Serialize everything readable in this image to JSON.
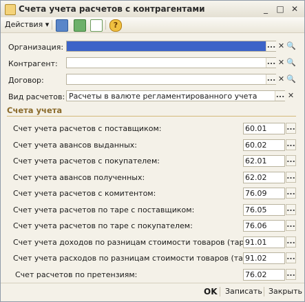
{
  "window": {
    "title": "Счета учета расчетов с контрагентами",
    "controls": {
      "minimize": "_",
      "maximize": "□",
      "close": "✕"
    }
  },
  "toolbar": {
    "actions_label": "Действия",
    "actions_arrow": "▾",
    "help_glyph": "?"
  },
  "form": {
    "organization": {
      "label": "Организация:",
      "value": ""
    },
    "counterparty": {
      "label": "Контрагент:",
      "value": ""
    },
    "contract": {
      "label": "Договор:",
      "value": ""
    },
    "settlement_type": {
      "label": "Вид расчетов:",
      "value": "Расчеты в валюте регламентированного учета"
    },
    "dots": "...",
    "clear": "✕",
    "search": "🔍"
  },
  "accounts": {
    "section_title": "Счета учета",
    "rows": [
      {
        "label": "Счет учета расчетов с поставщиком:",
        "value": "60.01"
      },
      {
        "label": "Счет учета авансов выданных:",
        "value": "60.02"
      },
      {
        "label": "Счет учета расчетов с покупателем:",
        "value": "62.01"
      },
      {
        "label": "Счет учета авансов полученных:",
        "value": "62.02"
      },
      {
        "label": "Счет учета расчетов с комитентом:",
        "value": "76.09"
      },
      {
        "label": "Счет учета расчетов по таре с поставщиком:",
        "value": "76.05"
      },
      {
        "label": "Счет учета расчетов по таре с покупателем:",
        "value": "76.06"
      },
      {
        "label": "Счет учета доходов по разницам стоимости товаров (тары):",
        "value": "91.01"
      },
      {
        "label": "Счет учета расходов по разницам стоимости товаров (тары):",
        "value": "91.02"
      },
      {
        "label": "Счет расчетов по претензиям:",
        "value": "76.02"
      }
    ]
  },
  "footer": {
    "ok_label": "OK",
    "save_label": "Записать",
    "close_label": "Закрыть"
  }
}
